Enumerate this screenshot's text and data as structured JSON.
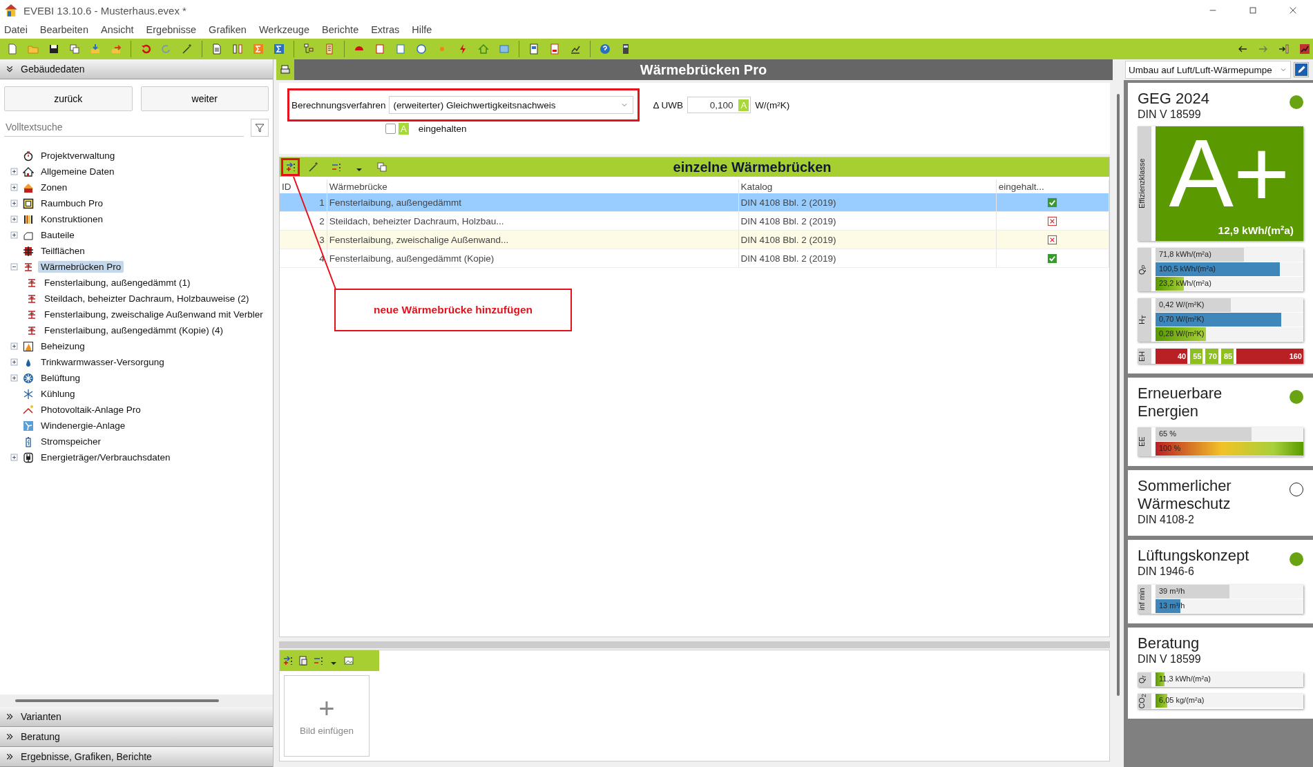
{
  "window": {
    "title": "EVEBI 13.10.6 - Musterhaus.evex *"
  },
  "menu": [
    "Datei",
    "Bearbeiten",
    "Ansicht",
    "Ergebnisse",
    "Grafiken",
    "Werkzeuge",
    "Berichte",
    "Extras",
    "Hilfe"
  ],
  "sidebar": {
    "header": "Gebäudedaten",
    "buttons": [
      "zurück",
      "weiter"
    ],
    "search": {
      "placeholder": "Volltextsuche"
    },
    "tree": [
      {
        "label": "Projektverwaltung",
        "selected": false
      },
      {
        "label": "Allgemeine Daten",
        "expanded": false,
        "selected": false
      },
      {
        "label": "Zonen",
        "expanded": false,
        "selected": false
      },
      {
        "label": "Raumbuch Pro",
        "expanded": false,
        "selected": false
      },
      {
        "label": "Konstruktionen",
        "expanded": false,
        "selected": false
      },
      {
        "label": "Bauteile",
        "expanded": false,
        "selected": false
      },
      {
        "label": "Teilflächen",
        "selected": false
      },
      {
        "label": "Wärmebrücken Pro",
        "expanded": true,
        "selected": true,
        "children": [
          {
            "label": "Fensterlaibung, außengedämmt (1)",
            "selected": false
          },
          {
            "label": "Steildach, beheizter Dachraum, Holzbauweise (2)",
            "selected": false
          },
          {
            "label": "Fensterlaibung, zweischalige Außenwand mit Verbler",
            "selected": false
          },
          {
            "label": "Fensterlaibung, außengedämmt (Kopie) (4)",
            "selected": false
          }
        ]
      },
      {
        "label": "Beheizung",
        "expanded": false,
        "selected": false
      },
      {
        "label": "Trinkwarmwasser-Versorgung",
        "expanded": false,
        "selected": false
      },
      {
        "label": "Belüftung",
        "expanded": false,
        "selected": false
      },
      {
        "label": "Kühlung",
        "selected": false
      },
      {
        "label": "Photovoltaik-Anlage Pro",
        "selected": false
      },
      {
        "label": "Windenergie-Anlage",
        "selected": false
      },
      {
        "label": "Stromspeicher",
        "selected": false
      },
      {
        "label": "Energieträger/Verbrauchsdaten",
        "expanded": false,
        "selected": false
      }
    ],
    "sections": [
      "Varianten",
      "Beratung",
      "Ergebnisse, Grafiken, Berichte"
    ]
  },
  "page": {
    "title": "Wärmebrücken Pro",
    "method": {
      "label": "Berechnungsverfahren",
      "value": "(erweiterter) Gleichwertigkeitsnachweis",
      "highlighted": true
    },
    "delta": {
      "label": "Δ UWB",
      "value": "0,100",
      "badge": "A",
      "unit": "W/(m²K)"
    },
    "fulfilled": {
      "label": "eingehalten",
      "badge": "A",
      "checked": false
    }
  },
  "list": {
    "title": "einzelne Wärmebrücken",
    "columns": [
      "ID",
      "Wärmebrücke",
      "Katalog",
      "eingehalt..."
    ],
    "rows": [
      {
        "id": "1",
        "name": "Fensterlaibung, außengedämmt",
        "catalog": "DIN 4108 Bbl. 2 (2019)",
        "ok": true,
        "selected": true
      },
      {
        "id": "2",
        "name": "Steildach, beheizter Dachraum, Holzbau...",
        "catalog": "DIN 4108 Bbl. 2 (2019)",
        "ok": false,
        "selected": false
      },
      {
        "id": "3",
        "name": "Fensterlaibung, zweischalige Außenwand...",
        "catalog": "DIN 4108 Bbl. 2 (2019)",
        "ok": false,
        "selected": false
      },
      {
        "id": "4",
        "name": "Fensterlaibung, außengedämmt (Kopie)",
        "catalog": "DIN 4108 Bbl. 2 (2019)",
        "ok": true,
        "selected": false
      }
    ]
  },
  "annotation": {
    "text": "neue Wärmebrücke hinzufügen"
  },
  "images": {
    "add_symbol": "+",
    "add_label": "Bild einfügen"
  },
  "variant": {
    "value": "Umbau auf Luft/Luft-Wärmepumpe"
  },
  "cards": [
    {
      "title": "GEG 2024",
      "subtitle": "DIN V 18599",
      "fulfilled": true,
      "class": {
        "axis_label": "Effizienzklasse",
        "grade": "A+",
        "value": "12,9 kWh/(m²a)"
      },
      "groups": [
        {
          "label": "Q$_{P}$",
          "bars": [
            {
              "text": "71,8 kWh/(m²a)",
              "kind": "reference",
              "level": 0.6
            },
            {
              "text": "100,5 kWh/(m²a)",
              "kind": "limit",
              "level": 0.84
            },
            {
              "text": "23,2 kWh/(m²a)",
              "kind": "actual",
              "level": 0.19
            }
          ]
        },
        {
          "label": "H$_{T}$",
          "bars": [
            {
              "text": "0,42 W/(m²K)",
              "kind": "reference",
              "level": 0.51
            },
            {
              "text": "0,70 W/(m²K)",
              "kind": "limit",
              "level": 0.85
            },
            {
              "text": "0,28 W/(m²K)",
              "kind": "actual",
              "level": 0.34
            }
          ]
        }
      ],
      "scale": {
        "label": "EH",
        "segments": [
          {
            "text": "40",
            "color": "#b82025"
          },
          {
            "text": "55",
            "color": "#8dbf1d"
          },
          {
            "text": "70",
            "color": "#8dbf1d"
          },
          {
            "text": "85",
            "color": "#8dbf1d"
          },
          {
            "text": "160",
            "color": "#b82025"
          }
        ]
      }
    },
    {
      "title": "Erneuerbare Energien",
      "fulfilled": true,
      "groups": [
        {
          "label": "EE",
          "bars": [
            {
              "text": "65 %",
              "kind": "reference",
              "level": 0.65
            },
            {
              "text": "100 %",
              "kind": "scale",
              "level": 1
            }
          ]
        }
      ]
    },
    {
      "title": "Sommerlicher Wärmeschutz",
      "subtitle": "DIN 4108-2",
      "fulfilled": false
    },
    {
      "title": "Lüftungskonzept",
      "subtitle": "DIN 1946-6",
      "fulfilled": true,
      "groups": [
        {
          "label": "inf min",
          "bars": [
            {
              "text": "39 m³/h",
              "kind": "reference",
              "level": 0.5
            },
            {
              "text": "13 m³/h",
              "kind": "limit",
              "level": 0.17
            }
          ]
        }
      ]
    },
    {
      "title": "Beratung",
      "subtitle": "DIN V 18599",
      "groups": [
        {
          "label": "Q$_{r}$",
          "bars": [
            {
              "text": "11,3 kWh/(m²a)",
              "kind": "actual",
              "level": 0.06
            }
          ]
        },
        {
          "label": "CO$_{2}$",
          "bars": [
            {
              "text": "6,05 kg/(m²a)",
              "kind": "actual",
              "level": 0.08
            }
          ]
        }
      ]
    }
  ]
}
